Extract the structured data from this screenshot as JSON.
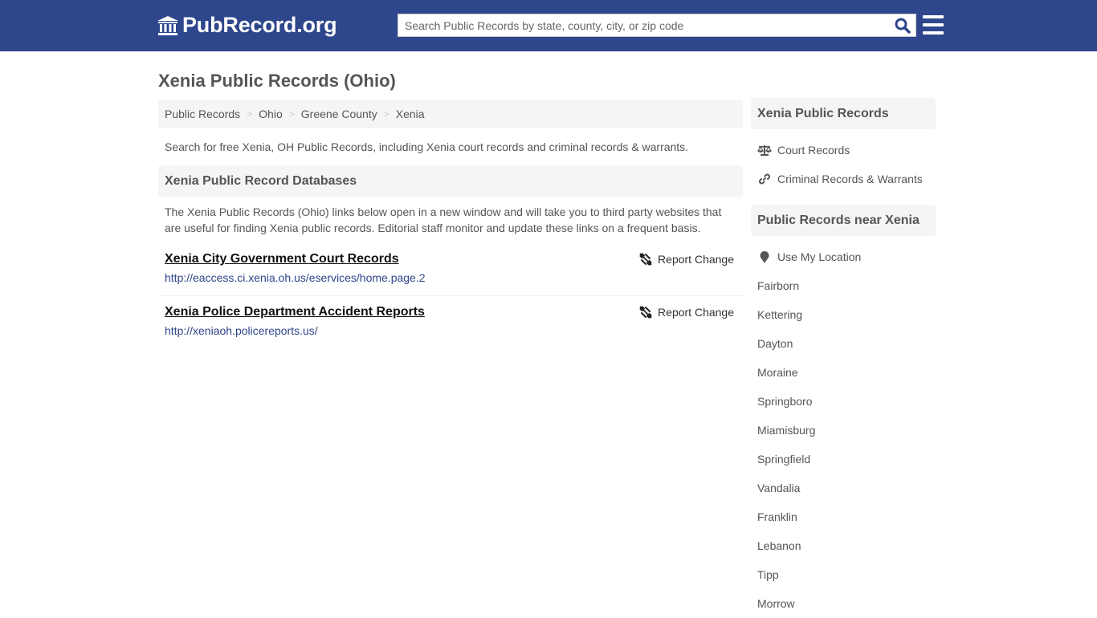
{
  "header": {
    "logo_text": "PubRecord.org",
    "search_placeholder": "Search Public Records by state, county, city, or zip code",
    "search_value": ""
  },
  "page": {
    "title": "Xenia Public Records (Ohio)"
  },
  "breadcrumb": [
    {
      "label": "Public Records"
    },
    {
      "label": "Ohio"
    },
    {
      "label": "Greene County"
    },
    {
      "label": "Xenia"
    }
  ],
  "breadcrumb_separator": ">",
  "intro": "Search for free Xenia, OH Public Records, including Xenia court records and criminal records & warrants.",
  "databases": {
    "heading": "Xenia Public Record Databases",
    "description": "The Xenia Public Records (Ohio) links below open in a new window and will take you to third party websites that are useful for finding Xenia public records. Editorial staff monitor and update these links on a frequent basis.",
    "records": [
      {
        "title": "Xenia City Government Court Records",
        "url": "http://eaccess.ci.xenia.oh.us/eservices/home.page.2",
        "report_label": "Report Change",
        "report_icon": "broken-link-icon"
      },
      {
        "title": "Xenia Police Department Accident Reports",
        "url": "http://xeniaoh.policereports.us/",
        "report_label": "Report Change",
        "report_icon": "broken-link-icon"
      }
    ]
  },
  "sidebar": {
    "section1": {
      "heading": "Xenia Public Records",
      "items": [
        {
          "label": "Court Records",
          "icon": "balance-scale-icon"
        },
        {
          "label": "Criminal Records & Warrants",
          "icon": "link-icon"
        }
      ]
    },
    "section2": {
      "heading": "Public Records near Xenia",
      "location_label": "Use My Location",
      "location_icon": "map-marker-icon",
      "cities": [
        "Fairborn",
        "Kettering",
        "Dayton",
        "Moraine",
        "Springboro",
        "Miamisburg",
        "Springfield",
        "Vandalia",
        "Franklin",
        "Lebanon",
        "Tipp",
        "Morrow"
      ]
    }
  },
  "colors": {
    "header_bg": "#2e468c",
    "link_url": "#2e468c",
    "panel_bg": "#f5f5f5",
    "search_icon": "#2e468c"
  }
}
